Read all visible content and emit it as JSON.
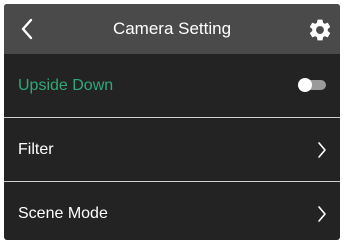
{
  "header": {
    "title": "Camera Setting",
    "back_icon": "chevron-left-icon",
    "settings_icon": "gear-icon"
  },
  "rows": [
    {
      "label": "Upside Down",
      "control": "toggle",
      "toggle_on": false,
      "label_color": "#2fa978"
    },
    {
      "label": "Filter",
      "control": "chevron-right-icon"
    },
    {
      "label": "Scene Mode",
      "control": "chevron-right-icon"
    }
  ],
  "colors": {
    "background": "#232323",
    "header": "#4a4a4a",
    "accent": "#2fa978",
    "divider": "#cfcfcf",
    "text": "#ffffff"
  }
}
